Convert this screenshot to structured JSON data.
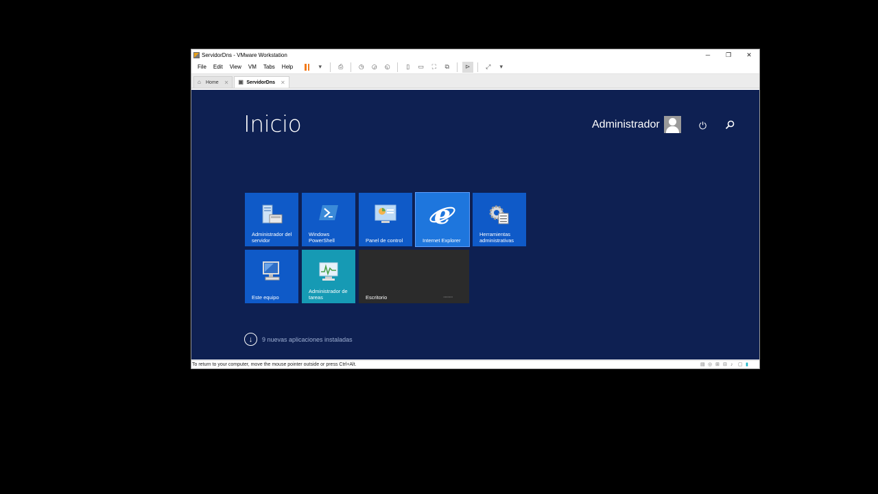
{
  "window": {
    "title": "ServidorDns - VMware Workstation",
    "controls": {
      "minimize": "─",
      "restore": "❐",
      "close": "✕"
    }
  },
  "menubar": {
    "items": [
      "File",
      "Edit",
      "View",
      "VM",
      "Tabs",
      "Help"
    ]
  },
  "tabs": [
    {
      "label": "Home",
      "icon": "home-icon"
    },
    {
      "label": "ServidorDns",
      "icon": "vm-icon"
    }
  ],
  "start": {
    "title": "Inicio",
    "user": "Administrador",
    "tiles": [
      {
        "label": "Administrador del servidor",
        "icon": "server-manager-icon"
      },
      {
        "label": "Windows PowerShell",
        "icon": "powershell-icon"
      },
      {
        "label": "Panel de control",
        "icon": "control-panel-icon"
      },
      {
        "label": "Internet Explorer",
        "icon": "internet-explorer-icon"
      },
      {
        "label": "Herramientas administrativas",
        "icon": "admin-tools-icon"
      },
      {
        "label": "Este equipo",
        "icon": "computer-icon"
      },
      {
        "label": "Administrador de tareas",
        "icon": "task-manager-icon"
      },
      {
        "label": "Escritorio",
        "icon": "desktop-icon"
      }
    ],
    "new_apps": "9 nuevas aplicaciones instaladas"
  },
  "statusbar": {
    "message": "To return to your computer, move the mouse pointer outside or press Ctrl+Alt."
  },
  "colors": {
    "start_background": "#0e2052",
    "tile_blue": "#0f5ac8",
    "tile_teal": "#169ab4",
    "tile_desktop": "#2b2b2b",
    "pause_orange": "#f27a1a"
  }
}
